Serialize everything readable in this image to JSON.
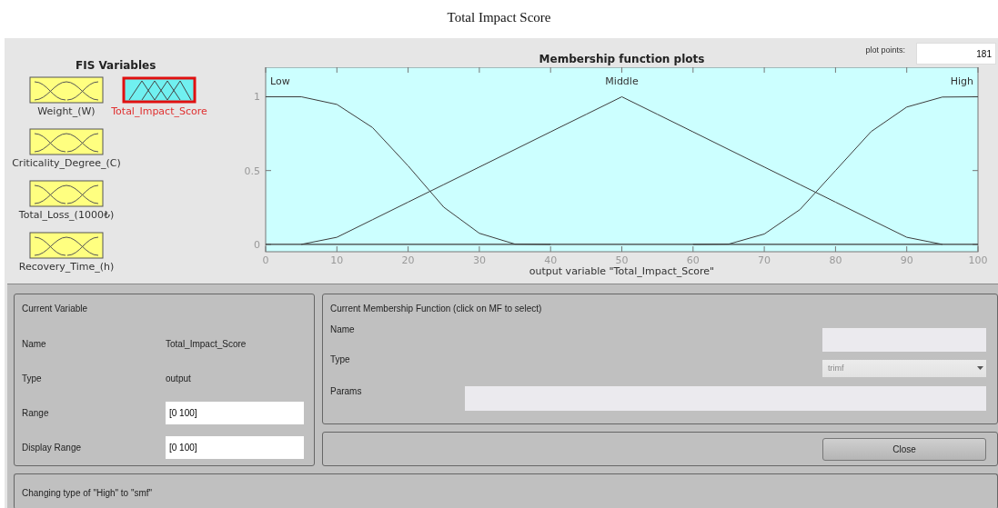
{
  "caption": "Total Impact Score",
  "fis_variables": {
    "title": "FIS Variables",
    "items": [
      {
        "label": "Weight_(W)",
        "kind": "input",
        "selected": false
      },
      {
        "label": "Total_Impact_Score",
        "kind": "output",
        "selected": true
      },
      {
        "label": "Criticality_Degree_(C)",
        "kind": "input",
        "selected": false
      },
      {
        "label": "Total_Loss_(1000₺)",
        "kind": "input",
        "selected": false
      },
      {
        "label": "Recovery_Time_(h)",
        "kind": "input",
        "selected": false
      }
    ]
  },
  "plot": {
    "title": "Membership function plots",
    "plot_points": {
      "label": "plot points:",
      "value": "181"
    },
    "chart_data": {
      "type": "line",
      "xlabel": "output variable \"Total_Impact_Score\"",
      "x": [
        0,
        5,
        10,
        15,
        20,
        25,
        30,
        35,
        40,
        45,
        50,
        55,
        60,
        65,
        70,
        75,
        80,
        85,
        90,
        95,
        100
      ],
      "series": [
        {
          "name": "Low",
          "color": "#3c3c3c",
          "values": [
            1,
            1,
            0.948,
            0.792,
            0.532,
            0.252,
            0.075,
            0.002,
            0,
            null,
            null,
            null,
            null,
            null,
            null,
            null,
            null,
            null,
            null,
            null,
            null
          ]
        },
        {
          "name": "Middle",
          "color": "#3c3c3c",
          "values": [
            null,
            0,
            0.048,
            0.167,
            0.286,
            0.405,
            0.524,
            0.643,
            0.762,
            0.881,
            1,
            0.881,
            0.762,
            0.643,
            0.524,
            0.405,
            0.286,
            0.167,
            0.048,
            0,
            null
          ]
        },
        {
          "name": "High",
          "color": "#3c3c3c",
          "values": [
            null,
            null,
            null,
            null,
            null,
            null,
            null,
            null,
            null,
            null,
            null,
            null,
            0,
            0.002,
            0.07,
            0.236,
            0.5,
            0.764,
            0.93,
            0.998,
            1
          ]
        }
      ],
      "xlim": [
        0,
        100
      ],
      "ylim": [
        -0.05,
        1.2
      ],
      "xticks": [
        0,
        10,
        20,
        30,
        40,
        50,
        60,
        70,
        80,
        90,
        100
      ],
      "yticks": [
        0,
        0.5,
        1
      ]
    }
  },
  "current_variable": {
    "title": "Current Variable",
    "rows": [
      {
        "label": "Name",
        "kind": "text",
        "value": "Total_Impact_Score"
      },
      {
        "label": "Type",
        "kind": "text",
        "value": "output"
      },
      {
        "label": "Range",
        "kind": "field",
        "value": "[0 100]"
      },
      {
        "label": "Display Range",
        "kind": "field",
        "value": "[0 100]"
      }
    ]
  },
  "current_mf": {
    "title": "Current Membership Function (click on MF to select)",
    "name_label": "Name",
    "type_label": "Type",
    "type_value": "trimf",
    "params_label": "Params"
  },
  "close_button": "Close",
  "status": "Changing type of \"High\" to \"smf\""
}
